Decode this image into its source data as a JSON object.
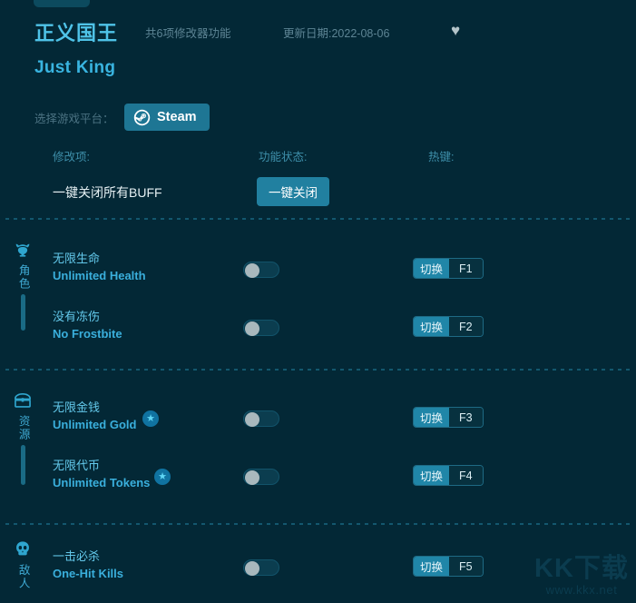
{
  "app": {
    "background": "#032836",
    "accent": "#2086a8",
    "title_color": "#4fc3e8"
  },
  "header": {
    "title_cn": "正义国王",
    "title_en": "Just King",
    "feature_count": "共6项修改器功能",
    "update_date": "更新日期:2022-08-06",
    "favorite_icon": "♥"
  },
  "platform": {
    "label": "选择游戏平台：",
    "selected": "Steam",
    "icon": "steam-icon"
  },
  "columns": {
    "name": "修改项:",
    "status": "功能状态:",
    "hotkey": "热键:"
  },
  "master": {
    "label": "一键关闭所有BUFF",
    "button": "一键关闭"
  },
  "groups": [
    {
      "icon": "helmet-icon",
      "name": "角色",
      "rows": [
        {
          "cn": "无限生命",
          "en": "Unlimited Health",
          "toggle": "off",
          "hotkey_action": "切换",
          "hotkey_key": "F1",
          "premium": false
        },
        {
          "cn": "没有冻伤",
          "en": "No Frostbite",
          "toggle": "off",
          "hotkey_action": "切换",
          "hotkey_key": "F2",
          "premium": false
        }
      ]
    },
    {
      "icon": "treasure-chest-icon",
      "name": "资源",
      "rows": [
        {
          "cn": "无限金钱",
          "en": "Unlimited Gold",
          "toggle": "off",
          "hotkey_action": "切换",
          "hotkey_key": "F3",
          "premium": true,
          "badge": "★"
        },
        {
          "cn": "无限代币",
          "en": "Unlimited Tokens",
          "toggle": "off",
          "hotkey_action": "切换",
          "hotkey_key": "F4",
          "premium": true,
          "badge": "★"
        }
      ]
    },
    {
      "icon": "skull-icon",
      "name": "敌人",
      "rows": [
        {
          "cn": "一击必杀",
          "en": "One-Hit Kills",
          "toggle": "off",
          "hotkey_action": "切换",
          "hotkey_key": "F5",
          "premium": false
        }
      ]
    }
  ],
  "watermark": {
    "main": "KK下载",
    "sub": "www.kkx.net"
  }
}
